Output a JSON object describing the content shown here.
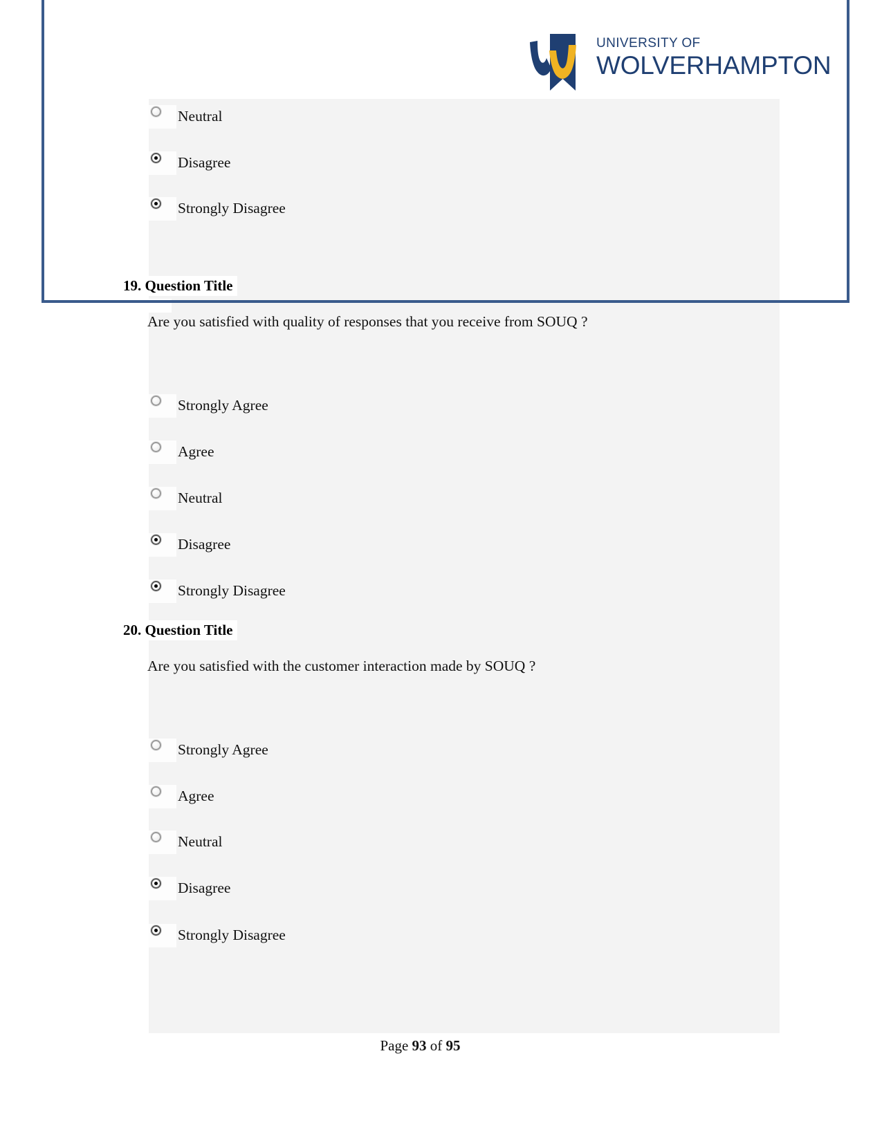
{
  "document": {
    "logo": {
      "line1": "UNIVERSITY OF",
      "line2": "WOLVERHAMPTON",
      "mark_name": "wolverhampton-w-ribbon-logo",
      "colors": {
        "navy": "#1f3f72",
        "gold": "#f0b323"
      }
    },
    "frame_color": "#3a5b8c",
    "band_color": "#f3f3f3"
  },
  "continued_question": {
    "options": [
      {
        "label": "Neutral",
        "selected": false
      },
      {
        "label": "Disagree",
        "selected": true
      },
      {
        "label": "Strongly Disagree",
        "selected": true
      }
    ]
  },
  "questions": [
    {
      "title": "19. Question Title",
      "text": "Are you satisfied with quality of responses that you receive from SOUQ ?",
      "options": [
        {
          "label": "Strongly Agree",
          "selected": false
        },
        {
          "label": "Agree",
          "selected": false
        },
        {
          "label": "Neutral",
          "selected": false
        },
        {
          "label": "Disagree",
          "selected": true
        },
        {
          "label": "Strongly Disagree",
          "selected": true
        }
      ]
    },
    {
      "title": "20. Question Title",
      "text": "Are you satisfied with the customer interaction made by SOUQ ?",
      "options": [
        {
          "label": "Strongly Agree",
          "selected": false
        },
        {
          "label": "Agree",
          "selected": false
        },
        {
          "label": "Neutral",
          "selected": false
        },
        {
          "label": "Disagree",
          "selected": true
        },
        {
          "label": "Strongly Disagree",
          "selected": true
        }
      ]
    }
  ],
  "footer": {
    "prefix": "Page ",
    "current_page": "93",
    "middle": " of ",
    "total_pages": "95"
  }
}
